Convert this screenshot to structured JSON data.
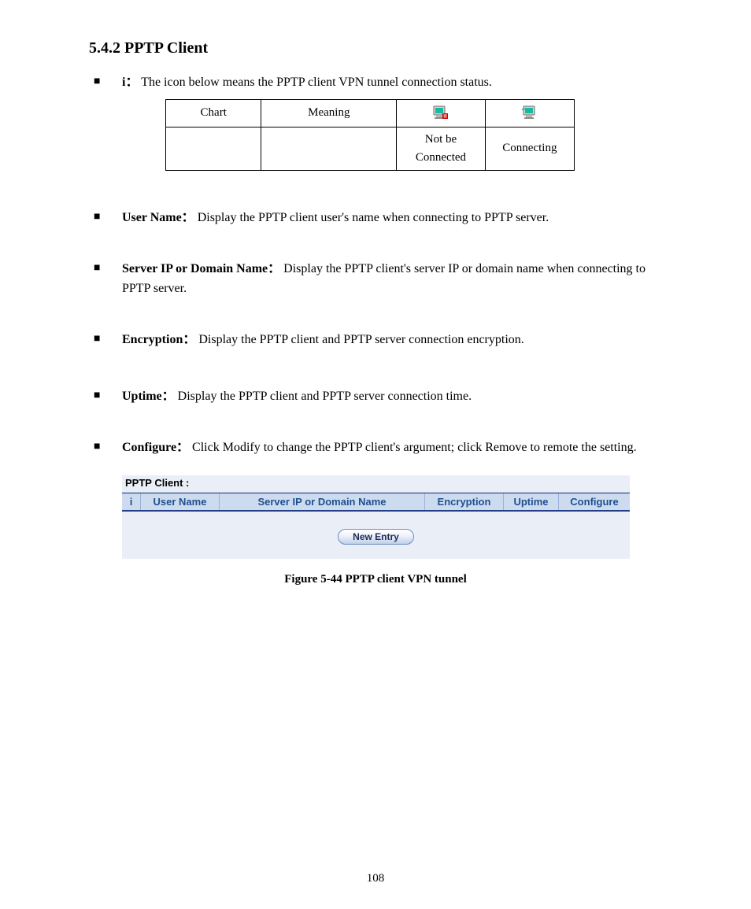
{
  "section_title": "5.4.2 PPTP Client",
  "bullets": {
    "b1": {
      "lead": "i：",
      "text": "The icon below means the PPTP client VPN tunnel connection status."
    },
    "b2": {
      "lead": "User Name：",
      "text": "Display the PPTP client user's name when connecting to PPTP server."
    },
    "b3": {
      "lead": "Server IP or Domain Name：",
      "text": "Display the PPTP client's server IP or domain name when connecting to PPTP server."
    },
    "b4": {
      "lead": "Encryption：",
      "text": "Display the PPTP client and PPTP server connection encryption."
    },
    "b5": {
      "lead": "Uptime：",
      "text": "Display the PPTP client and PPTP server connection time."
    },
    "b6": {
      "lead": "Configure：",
      "text": "Click Modify to change the PPTP client's argument; click Remove to remote the setting."
    }
  },
  "status_table": {
    "headers": {
      "c1": "Chart",
      "c2": "Meaning",
      "c3_icon": "pc-disconnected",
      "c4_icon": "pc-connected"
    },
    "row": {
      "c1": "",
      "c2": "",
      "c3": "Not be Connected",
      "c4": "Connecting"
    }
  },
  "pptp_panel": {
    "title": "PPTP Client :",
    "cols": {
      "i": "i",
      "user": "User Name",
      "server": "Server IP or Domain Name",
      "enc": "Encryption",
      "up": "Uptime",
      "conf": "Configure"
    },
    "button": "New Entry"
  },
  "figure_caption": "Figure 5-44 PPTP client VPN tunnel",
  "page_number": "108"
}
